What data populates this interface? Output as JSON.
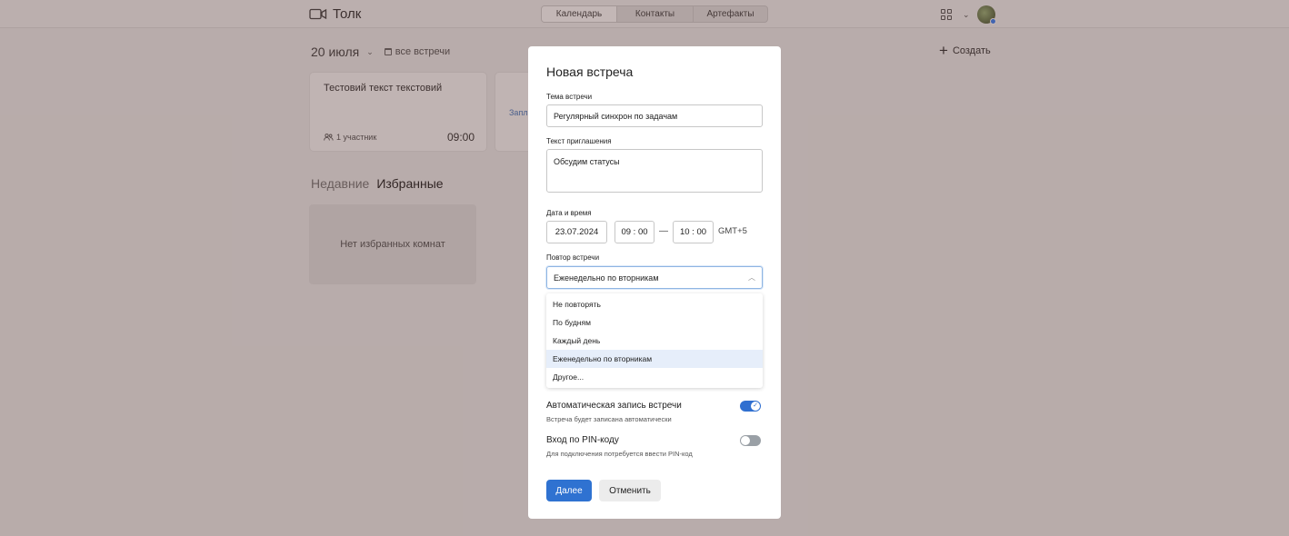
{
  "header": {
    "app_name": "Толк",
    "nav_tabs": [
      {
        "label": "Календарь",
        "active": true
      },
      {
        "label": "Контакты",
        "active": false
      },
      {
        "label": "Артефакты",
        "active": false
      }
    ]
  },
  "page": {
    "date_label": "20 июля",
    "all_meetings_label": "все встречи",
    "create_label": "Создать",
    "meeting_card": {
      "title": "Тестовий текст текстовий",
      "participants": "1 участник",
      "time": "09:00"
    },
    "card2_text": "Запл",
    "tabs": {
      "recent": "Недавние",
      "favorites": "Избранные"
    },
    "empty_favorites": "Нет избранных комнат"
  },
  "modal": {
    "title": "Новая встреча",
    "topic": {
      "label": "Тема встречи",
      "value": "Регулярный синхрон по задачам"
    },
    "invite": {
      "label": "Текст приглашения",
      "value": "Обсудим статусы"
    },
    "datetime": {
      "label": "Дата и время",
      "date": "23.07.2024",
      "start": "09 : 00",
      "end": "10 : 00",
      "separator": "—",
      "timezone": "GMT+5"
    },
    "repeat": {
      "label": "Повтор встречи",
      "selected": "Еженедельно по вторникам",
      "options": [
        "Не повторять",
        "По будням",
        "Каждый день",
        "Еженедельно по вторникам",
        "Другое..."
      ],
      "selected_index": 3
    },
    "auto_record": {
      "title": "Автоматическая запись встречи",
      "subtitle": "Встреча будет записана автоматически",
      "enabled": true
    },
    "pin_login": {
      "title": "Вход по PIN-коду",
      "subtitle": "Для подключения потребуется ввести PIN-код",
      "enabled": false
    },
    "buttons": {
      "next": "Далее",
      "cancel": "Отменить"
    }
  },
  "colors": {
    "primary": "#2f72d1",
    "overlay": "#8f7a76",
    "dropdown_selected": "#e6eefa",
    "toggle_off": "#9aa0a6"
  }
}
